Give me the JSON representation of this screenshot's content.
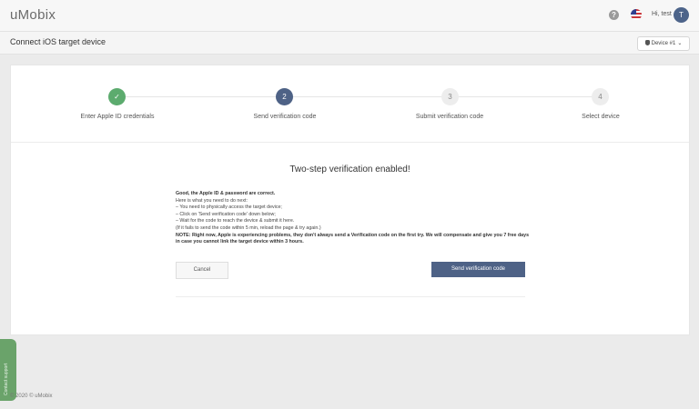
{
  "header": {
    "logo": "uMobix",
    "help_icon": "question-icon",
    "flag_icon": "us-flag-icon",
    "greeting": "Hi, test",
    "avatar_initial": "T"
  },
  "subheader": {
    "title": "Connect iOS target device",
    "device_select": {
      "icon": "apple-icon",
      "value": "Device #1",
      "chevron": "chevron-down-icon"
    }
  },
  "stepper": {
    "steps": [
      {
        "number": "✓",
        "label": "Enter Apple ID credentials",
        "state": "done"
      },
      {
        "number": "2",
        "label": "Send verification code",
        "state": "active"
      },
      {
        "number": "3",
        "label": "Submit verification code",
        "state": "pending"
      },
      {
        "number": "4",
        "label": "Select device",
        "state": "pending"
      }
    ]
  },
  "content": {
    "title": "Two-step verification enabled!",
    "lines": {
      "l1": "Good, the Apple ID & password are correct.",
      "l2": "Here is what you need to do next:",
      "l3": "– You need to physically access the target device;",
      "l4": "– Click on 'Send verification code' down below;",
      "l5": "– Wait for the code to reach the device & submit it here.",
      "l6": "(If it fails to send the code within 5 min, reload the page & try again.)",
      "l7": "NOTE: Right now, Apple is experiencing problems, they don't always send a Verification code on the first try. We will compensate and give you 7 free days in case you cannot link the target device within 3 hours."
    },
    "cancel_label": "Cancel",
    "send_label": "Send verification code"
  },
  "side_tab": {
    "label": "Contact support"
  },
  "footer": {
    "text": "© 2020 © uMobix"
  },
  "colors": {
    "primary": "#4e6286",
    "success": "#5cab6e",
    "side_tab": "#6aa36a"
  }
}
